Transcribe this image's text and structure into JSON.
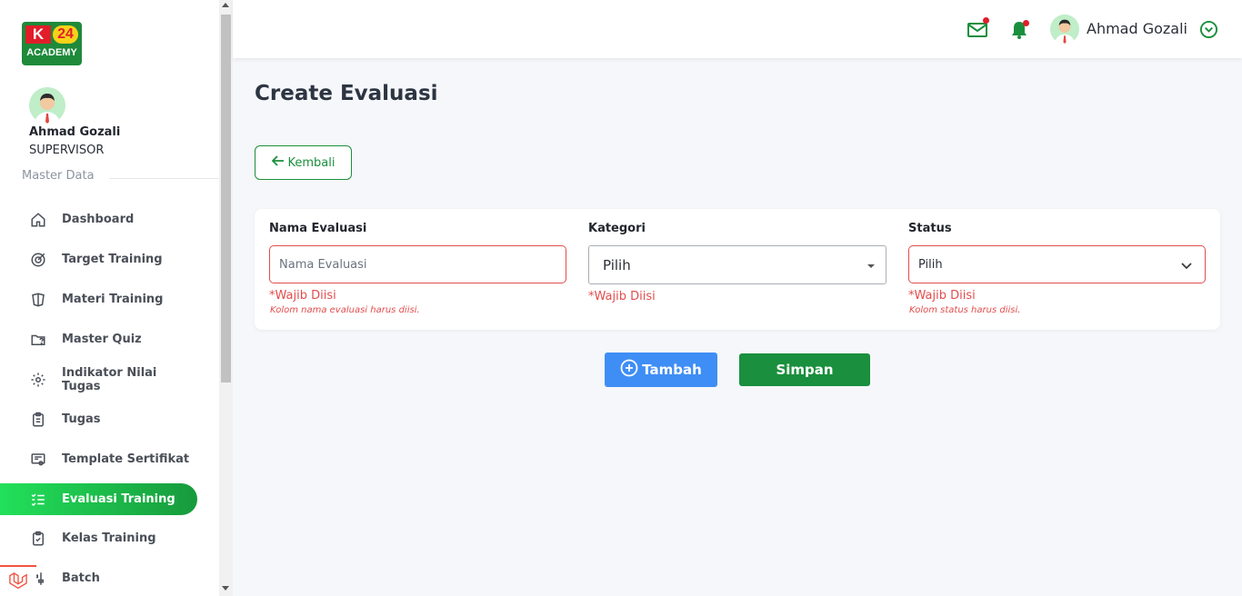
{
  "brand": {
    "logo_k": "K",
    "logo_24": "24",
    "logo_academy": "ACADEMY"
  },
  "user": {
    "name": "Ahmad Gozali",
    "role": "SUPERVISOR"
  },
  "sidebar": {
    "section": "Master Data",
    "items": [
      {
        "label": "Dashboard",
        "icon": "home-icon",
        "active": false
      },
      {
        "label": "Target Training",
        "icon": "target-icon",
        "active": false
      },
      {
        "label": "Materi Training",
        "icon": "book-icon",
        "active": false
      },
      {
        "label": "Master Quiz",
        "icon": "folder-question-icon",
        "active": false
      },
      {
        "label": "Indikator Nilai Tugas",
        "icon": "gear-icon",
        "active": false
      },
      {
        "label": "Tugas",
        "icon": "clipboard-icon",
        "active": false
      },
      {
        "label": "Template Sertifikat",
        "icon": "certificate-icon",
        "active": false
      },
      {
        "label": "Evaluasi Training",
        "icon": "checklist-icon",
        "active": true
      },
      {
        "label": "Kelas Training",
        "icon": "clipboard-check-icon",
        "active": false
      },
      {
        "label": "Batch",
        "icon": "sliders-icon",
        "active": false
      }
    ]
  },
  "topbar": {
    "user_name": "Ahmad Gozali"
  },
  "page": {
    "title": "Create Evaluasi",
    "back_label": "Kembali"
  },
  "form": {
    "nama": {
      "label": "Nama Evaluasi",
      "placeholder": "Nama Evaluasi",
      "required": "*Wajib Diisi",
      "hint": "Kolom nama evaluasi harus diisi."
    },
    "kategori": {
      "label": "Kategori",
      "value": "Pilih",
      "required": "*Wajib Diisi"
    },
    "status": {
      "label": "Status",
      "value": "Pilih",
      "required": "*Wajib Diisi",
      "hint": "Kolom status harus diisi."
    }
  },
  "actions": {
    "add_label": "Tambah",
    "save_label": "Simpan"
  },
  "colors": {
    "primary_green": "#1a8f3d",
    "active_gradient_start": "#22e05a",
    "blue": "#3f8ef5",
    "error": "#e24d4d"
  }
}
